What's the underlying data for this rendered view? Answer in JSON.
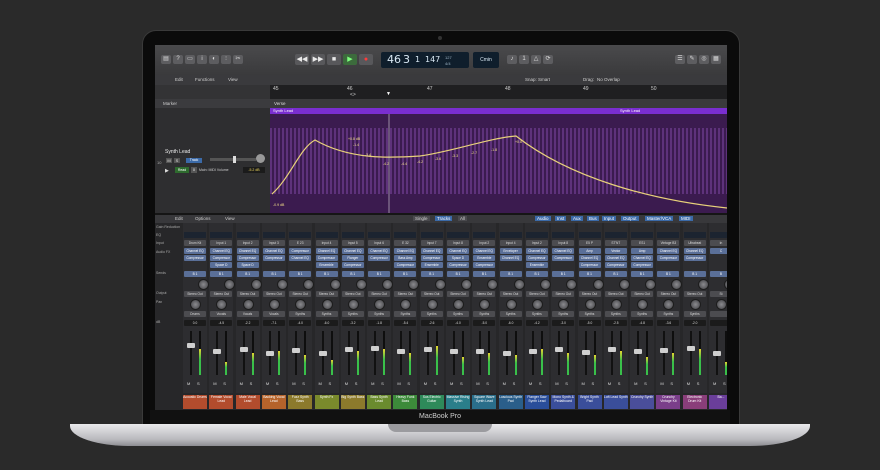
{
  "device": {
    "brand": "MacBook Pro"
  },
  "control_bar": {
    "position_bar": "46",
    "position_beat": "3",
    "position_sub": "1",
    "tempo": "147",
    "key": "Cmin",
    "tempo_label": "127",
    "signature": "4/4"
  },
  "track_menu": {
    "edit": "Edit",
    "functions": "Functions",
    "view": "View",
    "snap_label": "Snap:",
    "snap_value": "Smart",
    "drag_label": "Drag:",
    "drag_value": "No Overlap"
  },
  "ruler": {
    "marks": [
      "45",
      "46",
      "47",
      "48",
      "49",
      "50"
    ],
    "sub": "<>"
  },
  "marker_label": "Marker",
  "arrangement": {
    "section": "Verse"
  },
  "track": {
    "name": "Synth Lead",
    "number": "10",
    "m": "M",
    "s": "S",
    "track_btn": "Track",
    "read": "Read",
    "param": "Main: MIDI Volume",
    "value": "-5.2 dB",
    "mini": "0"
  },
  "region": {
    "name_left": "Synth Lead",
    "name_right": "Synth Lead",
    "points": [
      "+0.8 dB",
      "-1.4",
      "-3.4",
      "-4.2",
      "-4.4",
      "-4.2",
      "-3.6",
      "-3.3",
      "-2.7",
      "-1.8",
      "+0.8",
      "-0.9"
    ],
    "start": "-0.9 dB"
  },
  "mixer_menu": {
    "edit": "Edit",
    "options": "Options",
    "view": "View",
    "single": "Single",
    "tracks": "Tracks",
    "all": "All",
    "filters": [
      "Audio",
      "Inst",
      "Aux",
      "Bus",
      "Input",
      "Output",
      "Master/VCA",
      "MIDI"
    ]
  },
  "mixer_rows": [
    "Gain Reduction",
    "EQ",
    "Input",
    "Audio FX",
    "Sends",
    "Output",
    "Pan",
    "dB"
  ],
  "strips": [
    {
      "name": "Acoustic Drums",
      "color": "#b24c2d",
      "input": "Drum Kit",
      "fx": [
        "Channel EQ",
        "Compressor"
      ],
      "send": "B 1",
      "out": "Stereo Out",
      "group": "Drums",
      "db": "0.0",
      "fader": 0.7,
      "meter": 0.6
    },
    {
      "name": "Female Vocal Lead",
      "color": "#b24c2d",
      "input": "Input 1",
      "fx": [
        "Channel EQ",
        "Compressor",
        "Space D"
      ],
      "send": "B 1",
      "out": "Stereo Out",
      "group": "Vocals",
      "db": "-4.5",
      "fader": 0.55,
      "meter": 0.3
    },
    {
      "name": "Male Vocal Lead",
      "color": "#b24c2d",
      "input": "Input 2",
      "fx": [
        "Channel EQ",
        "Compressor",
        "Space D"
      ],
      "send": "B 1",
      "out": "Stereo Out",
      "group": "Vocals",
      "db": "-2.2",
      "fader": 0.6,
      "meter": 0.5
    },
    {
      "name": "Backing Vocal Lead",
      "color": "#b5632b",
      "input": "Input 3",
      "fx": [
        "Channel EQ",
        "Compressor"
      ],
      "send": "B 1",
      "out": "Stereo Out",
      "group": "Vocals",
      "db": "-7.1",
      "fader": 0.5,
      "meter": 0.55
    },
    {
      "name": "Fuzz Synth Bass",
      "color": "#8c7a2c",
      "input": "E 23",
      "fx": [
        "Compressor",
        "Channel EQ"
      ],
      "send": "B 1",
      "out": "Stereo Out",
      "group": "Synths",
      "db": "-4.0",
      "fader": 0.58,
      "meter": 0.45
    },
    {
      "name": "Synth Fx",
      "color": "#7a8a2c",
      "input": "Input 4",
      "fx": [
        "Channel EQ",
        "Compressor",
        "Ensemble"
      ],
      "send": "B 1",
      "out": "Stereo Out",
      "group": "Synths",
      "db": "-6.0",
      "fader": 0.5,
      "meter": 0.35
    },
    {
      "name": "Big Synth Bass",
      "color": "#8c7a2c",
      "input": "Input 5",
      "fx": [
        "Channel EQ",
        "Flanger",
        "Compressor"
      ],
      "send": "B 1",
      "out": "Stereo Out",
      "group": "Synths",
      "db": "-3.2",
      "fader": 0.6,
      "meter": 0.55
    },
    {
      "name": "Bass Synth Lead",
      "color": "#6a8b2e",
      "input": "Input 6",
      "fx": [
        "Channel EQ",
        "Compressor"
      ],
      "send": "B 1",
      "out": "Stereo Out",
      "group": "Synths",
      "db": "-1.8",
      "fader": 0.62,
      "meter": 0.6
    },
    {
      "name": "Heavy Funk Bass",
      "color": "#3c8a3a",
      "input": "E 32",
      "fx": [
        "Channel EQ",
        "Bass Amp",
        "Compressor"
      ],
      "send": "B 1",
      "out": "Stereo Out",
      "group": "Synths",
      "db": "-5.4",
      "fader": 0.55,
      "meter": 0.5
    },
    {
      "name": "Sus Electric Guitar",
      "color": "#2e8a5a",
      "input": "Input 7",
      "fx": [
        "Channel EQ",
        "Compressor",
        "Ensemble"
      ],
      "send": "B 1",
      "out": "Stereo Out",
      "group": "Synths",
      "db": "-2.6",
      "fader": 0.6,
      "meter": 0.65
    },
    {
      "name": "Massive Rising Synth",
      "color": "#2a7e8a",
      "input": "Input 8",
      "fx": [
        "Channel EQ",
        "Space D",
        "Compressor"
      ],
      "send": "B 1",
      "out": "Stereo Out",
      "group": "Synths",
      "db": "-4.0",
      "fader": 0.55,
      "meter": 0.4
    },
    {
      "name": "Square Wave Synth Lead",
      "color": "#2a6e8a",
      "input": "Input 2",
      "fx": [
        "Channel EQ",
        "Ensemble",
        "Compressor"
      ],
      "send": "B 1",
      "out": "Stereo Out",
      "group": "Synths",
      "db": "-5.0",
      "fader": 0.55,
      "meter": 0.5
    },
    {
      "name": "Luscious Synth Pad",
      "color": "#2a5e8a",
      "input": "Input 4",
      "fx": [
        "Enveloper",
        "Channel EQ"
      ],
      "send": "B 1",
      "out": "Stereo Out",
      "group": "Synths",
      "db": "-6.0",
      "fader": 0.5,
      "meter": 0.45
    },
    {
      "name": "Flanger Saw Synth Lead",
      "color": "#2a4e9a",
      "input": "Input 2",
      "fx": [
        "Channel EQ",
        "Compressor",
        "Ensemble"
      ],
      "send": "B 1",
      "out": "Stereo Out",
      "group": "Synths",
      "db": "-4.2",
      "fader": 0.56,
      "meter": 0.6
    },
    {
      "name": "Mono Synth & Pedalboard",
      "color": "#3a4e9a",
      "input": "Input 8",
      "fx": [
        "Channel EQ",
        "Compressor"
      ],
      "send": "B 1",
      "out": "Stereo Out",
      "group": "Synths",
      "db": "-3.0",
      "fader": 0.6,
      "meter": 0.5
    },
    {
      "name": "Bright Synth Pad",
      "color": "#3a4e9a",
      "input": "E5 P",
      "fx": [
        "Amp",
        "Channel EQ",
        "Compressor"
      ],
      "send": "B 1",
      "out": "Stereo Out",
      "group": "Synths",
      "db": "-5.0",
      "fader": 0.52,
      "meter": 0.45
    },
    {
      "name": "Loft Lead Synth",
      "color": "#3a4e9a",
      "input": "ST'NT",
      "fx": [
        "Vector",
        "Channel EQ",
        "Compressor"
      ],
      "send": "B 1",
      "out": "Stereo Out",
      "group": "Synths",
      "db": "-2.5",
      "fader": 0.6,
      "meter": 0.55
    },
    {
      "name": "Crunchy Synth",
      "color": "#4a4e9a",
      "input": "ES1",
      "fx": [
        "Amp",
        "Channel EQ",
        "Compressor"
      ],
      "send": "B 1",
      "out": "Stereo Out",
      "group": "Synths",
      "db": "-4.8",
      "fader": 0.54,
      "meter": 0.4
    },
    {
      "name": "Crunchy Vintage Kit",
      "color": "#7a3e8a",
      "input": "Vintage B3",
      "fx": [
        "Channel EQ",
        "Compressor"
      ],
      "send": "B 1",
      "out": "Stereo Out",
      "group": "Synths",
      "db": "-3.6",
      "fader": 0.58,
      "meter": 0.5
    },
    {
      "name": "Electronic Drum Kit",
      "color": "#8a3e7a",
      "input": "Ultrabeat",
      "fx": [
        "Channel EQ",
        "Compressor"
      ],
      "send": "B 1",
      "out": "Stereo Out",
      "group": "Synths",
      "db": "-2.0",
      "fader": 0.62,
      "meter": 0.6
    },
    {
      "name": "Ba...",
      "color": "#6a3e9a",
      "input": "In",
      "fx": [
        "C"
      ],
      "send": "B",
      "out": "St",
      "group": "",
      "db": "",
      "fader": 0.5,
      "meter": 0.3
    }
  ]
}
